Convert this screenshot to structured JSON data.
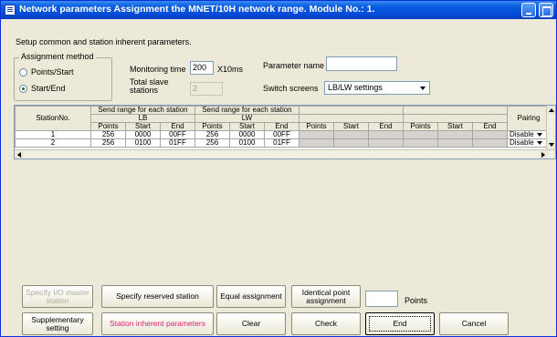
{
  "window": {
    "title": "Network parameters  Assignment the MNET/10H network range. Module No.: 1."
  },
  "intro_text": "Setup common and station inherent parameters.",
  "assignment_method": {
    "legend": "Assignment method",
    "options": [
      {
        "label": "Points/Start",
        "checked": false
      },
      {
        "label": "Start/End",
        "checked": true
      }
    ]
  },
  "monitoring_time": {
    "label": "Monitoring time",
    "value": "200",
    "unit": "X10ms"
  },
  "parameter_name": {
    "label": "Parameter name",
    "value": ""
  },
  "total_slave_stations": {
    "label_line1": "Total slave",
    "label_line2": "stations",
    "value": "2"
  },
  "switch_screens": {
    "label": "Switch screens",
    "value": "LB/LW settings"
  },
  "table": {
    "station_header": "StationNo.",
    "send_range_header": "Send range for each station",
    "lb_header": "LB",
    "lw_header": "LW",
    "pairing_header": "Pairing",
    "sub_headers": [
      "Points",
      "Start",
      "End"
    ],
    "rows": [
      {
        "station": "1",
        "lb_points": "256",
        "lb_start": "0000",
        "lb_end": "00FF",
        "lw_points": "256",
        "lw_start": "0000",
        "lw_end": "00FF",
        "pairing": "Disable"
      },
      {
        "station": "2",
        "lb_points": "256",
        "lb_start": "0100",
        "lb_end": "01FF",
        "lw_points": "256",
        "lw_start": "0100",
        "lw_end": "01FF",
        "pairing": "Disable"
      }
    ]
  },
  "buttons": {
    "specify_io_master_l1": "Specify I/O master",
    "specify_io_master_l2": "station",
    "specify_reserved": "Specify reserved station",
    "equal_assignment": "Equal assignment",
    "identical_l1": "Identical point",
    "identical_l2": "assignment",
    "points_label": "Points",
    "supplementary_l1": "Supplementary",
    "supplementary_l2": "setting",
    "station_inherent": "Station inherent parameters",
    "clear": "Clear",
    "check": "Check",
    "end": "End",
    "cancel": "Cancel"
  },
  "points_input_value": "",
  "colors": {
    "title_bar": "#0349d6",
    "window_bg": "#ece9d8",
    "highlight_text": "#e0206e"
  },
  "icons": [
    "window-icon",
    "minimize-icon",
    "maximize-icon",
    "dropdown-arrow-icon",
    "scroll-up-icon",
    "scroll-down-icon",
    "scroll-left-icon",
    "scroll-right-icon"
  ]
}
